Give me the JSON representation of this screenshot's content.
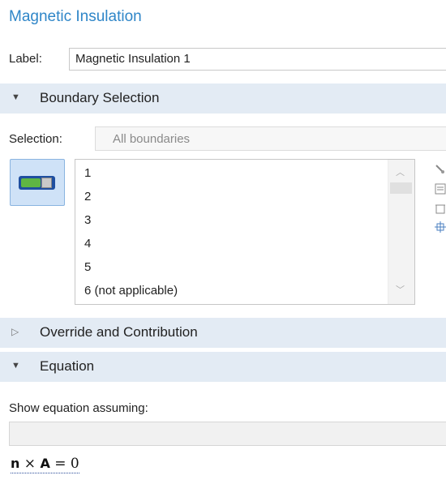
{
  "panel": {
    "title": "Magnetic Insulation"
  },
  "label_field": {
    "label": "Label:",
    "value": "Magnetic Insulation 1"
  },
  "sections": {
    "boundary_selection": {
      "label": "Boundary Selection",
      "expanded": true
    },
    "override": {
      "label": "Override and Contribution",
      "expanded": false
    },
    "equation": {
      "label": "Equation",
      "expanded": true
    }
  },
  "selection": {
    "label": "Selection:",
    "value": "All boundaries",
    "items": [
      "1",
      "2",
      "3",
      "4",
      "5",
      "6 (not applicable)"
    ]
  },
  "icons": {
    "section_expanded": "▼",
    "section_collapsed": "▷",
    "scroll_up": "︿",
    "scroll_down": "﹀",
    "toggle": "toggle-active-icon",
    "side_tools": [
      "paste-icon",
      "copy-icon",
      "clear-icon",
      "zoom-extents-icon"
    ]
  },
  "equation": {
    "show_label": "Show equation assuming:",
    "n": "n",
    "cross": " × ",
    "A": "A",
    "rhs": " = 0"
  },
  "colors": {
    "title": "#2f86c8",
    "section_bg": "#e3ebf4",
    "toggle_bg": "#cfe2f7"
  }
}
